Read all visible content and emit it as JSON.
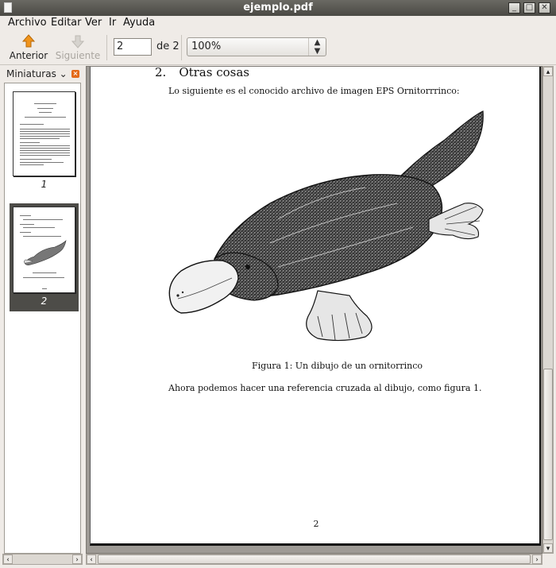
{
  "window": {
    "title": "ejemplo.pdf"
  },
  "menubar": {
    "items": [
      "Archivo",
      "Editar",
      "Ver",
      "Ir",
      "Ayuda"
    ]
  },
  "toolbar": {
    "prev_label": "Anterior",
    "next_label": "Siguiente",
    "page_value": "2",
    "page_of": "de 2",
    "zoom_value": "100%"
  },
  "sidebar": {
    "title": "Miniaturas",
    "thumbnails": [
      {
        "label": "1"
      },
      {
        "label": "2"
      }
    ]
  },
  "document": {
    "section_number": "2.",
    "section_title": "Otras cosas",
    "intro": "Lo siguiente es el conocido archivo de imagen EPS Ornitorrrinco:",
    "caption": "Figura 1: Un dibujo de un ornitorrinco",
    "after_text": "Ahora podemos hacer una referencia cruzada al dibujo, como figura 1.",
    "page_number": "2"
  },
  "colors": {
    "selection": "#4d4c48",
    "accent_arrow": "#f0941c",
    "titlebar": "#5a5954"
  }
}
